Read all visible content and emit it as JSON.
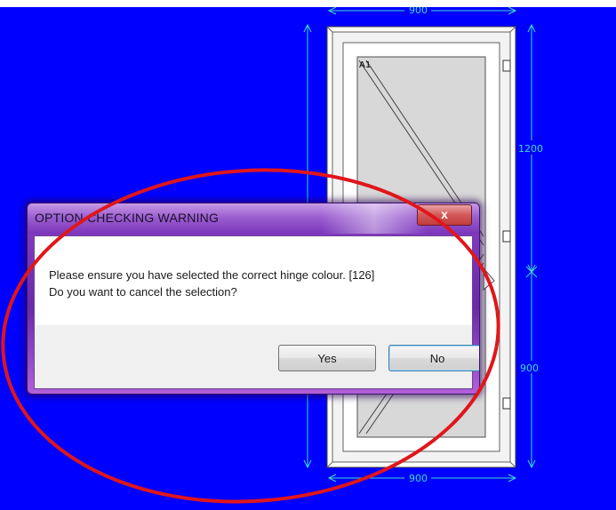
{
  "drawing": {
    "background_color": "#0000ff",
    "dimension_color": "#3ddcc8",
    "dimensions": {
      "top_width": "900",
      "bottom_width": "900",
      "right_upper_height": "1200",
      "right_lower_height": "900"
    },
    "sash_label": "A1"
  },
  "annotation": {
    "ellipse_color": "#e0161b"
  },
  "dialog": {
    "title": "OPTION CHECKING WARNING",
    "close_glyph": "x",
    "message_line1": "Please ensure you have selected the correct hinge colour. [126]",
    "message_line2": "Do you want to cancel the selection?",
    "yes_label": "Yes",
    "no_label": "No"
  }
}
